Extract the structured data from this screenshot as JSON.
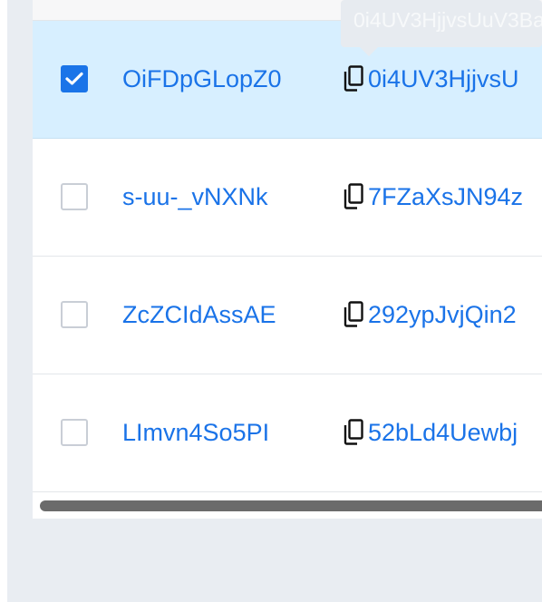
{
  "tooltip": {
    "text": "0i4UV3HjjvsUuV3Ba"
  },
  "rows": [
    {
      "name": "OiFDpGLopZ0",
      "id": "0i4UV3HjjvsU",
      "selected": true
    },
    {
      "name": "s-uu-_vNXNk",
      "id": "7FZaXsJN94z",
      "selected": false
    },
    {
      "name": "ZcZCIdAssAE",
      "id": "292ypJvjQin2",
      "selected": false
    },
    {
      "name": "LImvn4So5PI",
      "id": "52bLd4Uewbj",
      "selected": false
    }
  ],
  "icons": {
    "copy": "copy-icon",
    "check": "checkmark-icon"
  },
  "colors": {
    "link": "#1a73e8",
    "selected_row": "#d7efff",
    "checkbox_checked": "#1a74e8"
  }
}
